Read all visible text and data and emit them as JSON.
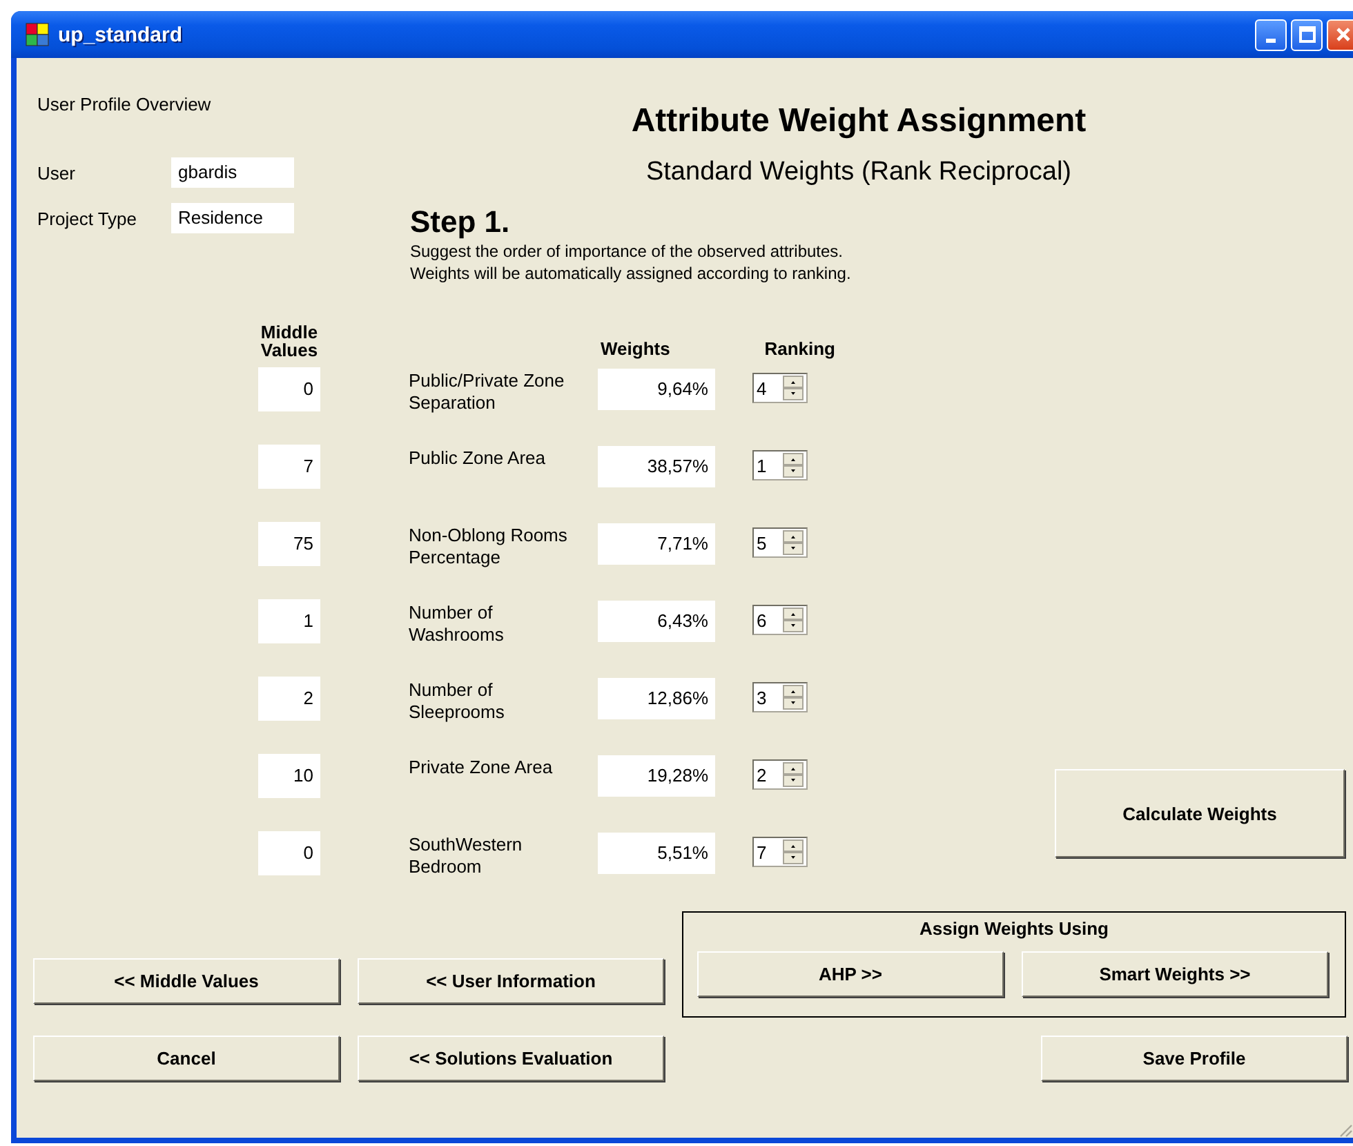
{
  "window": {
    "title": "up_standard"
  },
  "profile": {
    "heading": "User Profile Overview",
    "fields": [
      {
        "label": "User",
        "value": "gbardis"
      },
      {
        "label": "Project Type",
        "value": "Residence"
      }
    ]
  },
  "header": {
    "title": "Attribute Weight Assignment",
    "subtitle": "Standard Weights (Rank Reciprocal)"
  },
  "step": {
    "title": "Step 1.",
    "lines": [
      "Suggest the order of importance of the observed attributes.",
      "Weights will be automatically assigned according to ranking."
    ]
  },
  "columns": {
    "middle_values": "Middle Values",
    "weights": "Weights",
    "ranking": "Ranking"
  },
  "attributes": [
    {
      "middle_value": "0",
      "name": "Public/Private Zone Separation",
      "weight": "9,64%",
      "rank": "4"
    },
    {
      "middle_value": "7",
      "name": "Public Zone Area",
      "weight": "38,57%",
      "rank": "1"
    },
    {
      "middle_value": "75",
      "name": "Non-Oblong Rooms Percentage",
      "weight": "7,71%",
      "rank": "5"
    },
    {
      "middle_value": "1",
      "name": "Number of Washrooms",
      "weight": "6,43%",
      "rank": "6"
    },
    {
      "middle_value": "2",
      "name": "Number of Sleeprooms",
      "weight": "12,86%",
      "rank": "3"
    },
    {
      "middle_value": "10",
      "name": "Private Zone Area",
      "weight": "19,28%",
      "rank": "2"
    },
    {
      "middle_value": "0",
      "name": "SouthWestern Bedroom",
      "weight": "5,51%",
      "rank": "7"
    }
  ],
  "calculate_button": "Calculate Weights",
  "assign_group": {
    "title": "Assign Weights Using",
    "buttons": [
      "AHP >>",
      "Smart Weights >>"
    ]
  },
  "nav_buttons": [
    "<< Middle Values",
    "<< User Information",
    "Cancel",
    "<< Solutions Evaluation"
  ],
  "save_button": "Save Profile"
}
